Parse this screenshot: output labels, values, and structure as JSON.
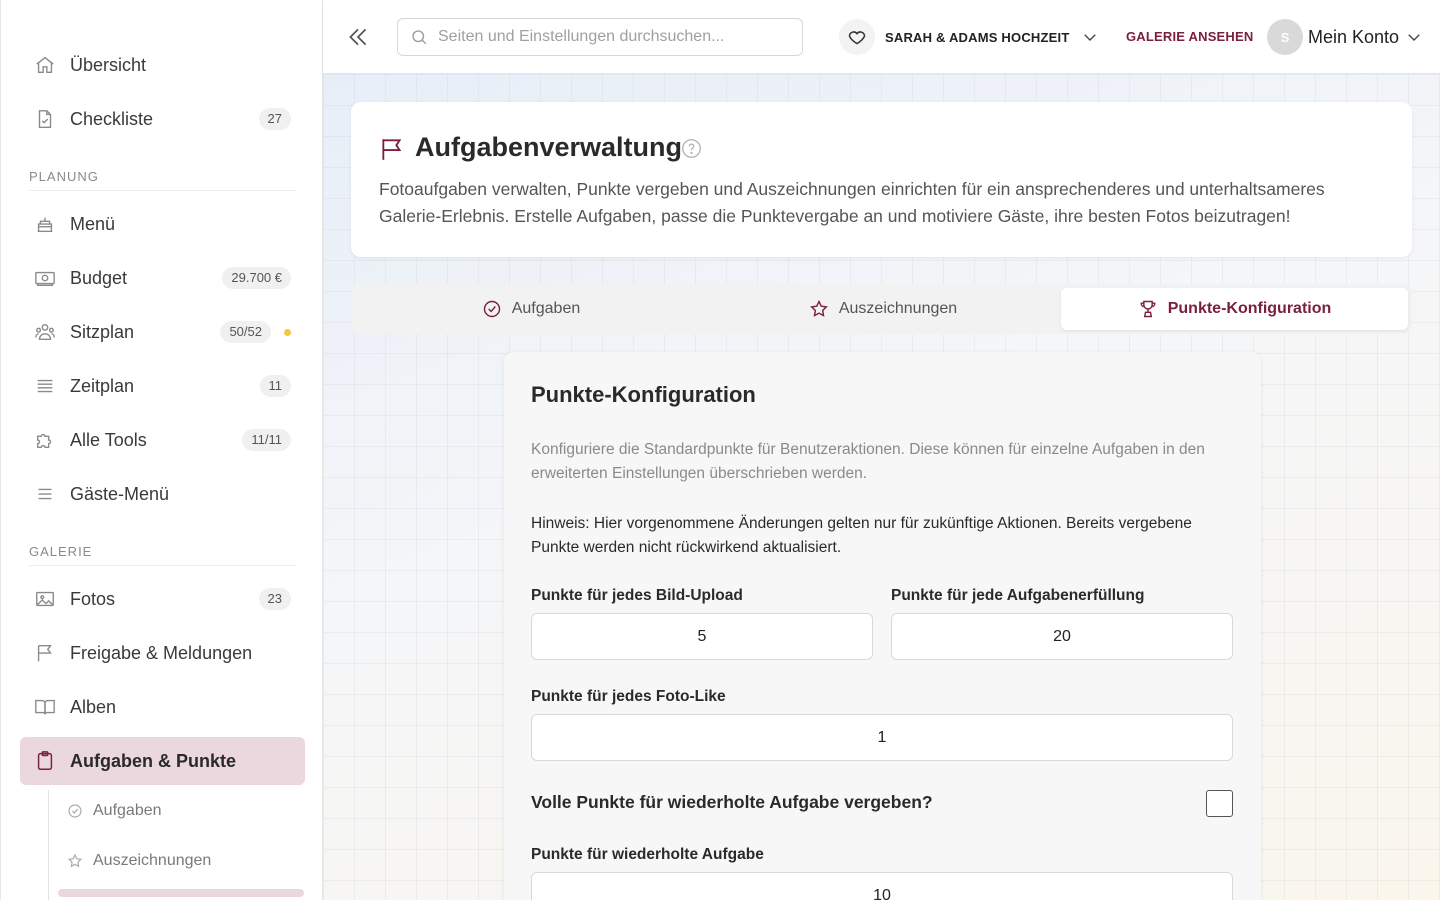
{
  "sidebar": {
    "items_top": [
      {
        "label": "Übersicht",
        "icon": "home-icon"
      },
      {
        "label": "Checkliste",
        "icon": "checklist-icon",
        "badge": "27"
      }
    ],
    "planning_section": "PLANUNG",
    "planning_items": [
      {
        "label": "Menü",
        "icon": "cake-icon"
      },
      {
        "label": "Budget",
        "icon": "money-icon",
        "badge": "29.700 €"
      },
      {
        "label": "Sitzplan",
        "icon": "people-icon",
        "badge": "50/52"
      },
      {
        "label": "Zeitplan",
        "icon": "list-icon",
        "badge": "11"
      },
      {
        "label": "Alle Tools",
        "icon": "puzzle-icon",
        "badge": "11/11"
      },
      {
        "label": "Gäste-Menü",
        "icon": "menu-icon"
      }
    ],
    "gallery_section": "GALERIE",
    "gallery_items": [
      {
        "label": "Fotos",
        "icon": "image-icon",
        "badge": "23"
      },
      {
        "label": "Freigabe & Meldungen",
        "icon": "flag-icon"
      },
      {
        "label": "Alben",
        "icon": "book-icon"
      },
      {
        "label": "Aufgaben & Punkte",
        "icon": "clipboard-icon"
      }
    ],
    "sub_items": [
      {
        "label": "Aufgaben",
        "icon": "check-circle-icon"
      },
      {
        "label": "Auszeichnungen",
        "icon": "star-icon"
      }
    ]
  },
  "topbar": {
    "search_placeholder": "Seiten und Einstellungen durchsuchen...",
    "event_name": "SARAH & ADAMS HOCHZEIT",
    "gallery_link": "GALERIE ANSEHEN",
    "avatar_initial": "S",
    "account_label": "Mein Konto"
  },
  "header": {
    "title": "Aufgabenverwaltung",
    "description": "Fotoaufgaben verwalten, Punkte vergeben und Auszeichnungen einrichten für ein ansprechenderes und unterhaltsameres Galerie-Erlebnis. Erstelle Aufgaben, passe die Punktevergabe an und motiviere Gäste, ihre besten Fotos beizutragen!"
  },
  "tabs": [
    {
      "label": "Aufgaben",
      "icon": "check-circle-icon"
    },
    {
      "label": "Auszeichnungen",
      "icon": "star-icon"
    },
    {
      "label": "Punkte-Konfiguration",
      "icon": "trophy-icon",
      "active": true
    }
  ],
  "config": {
    "title": "Punkte-Konfiguration",
    "description": "Konfiguriere die Standardpunkte für Benutzeraktionen. Diese können für einzelne Aufgaben in den erweiterten Einstellungen überschrieben werden.",
    "note": "Hinweis: Hier vorgenommene Änderungen gelten nur für zukünftige Aktionen. Bereits vergebene Punkte werden nicht rückwirkend aktualisiert.",
    "upload_label": "Punkte für jedes Bild-Upload",
    "upload_value": "5",
    "task_label": "Punkte für jede Aufgabenerfüllung",
    "task_value": "20",
    "like_label": "Punkte für jedes Foto-Like",
    "like_value": "1",
    "repeat_full_label": "Volle Punkte für wiederholte Aufgabe vergeben?",
    "repeat_full_checked": false,
    "repeat_label": "Punkte für wiederholte Aufgabe",
    "repeat_value": "10"
  },
  "colors": {
    "accent": "#7a1f3d",
    "active_bg": "#ead8de",
    "status_dot": "#f2c744"
  }
}
